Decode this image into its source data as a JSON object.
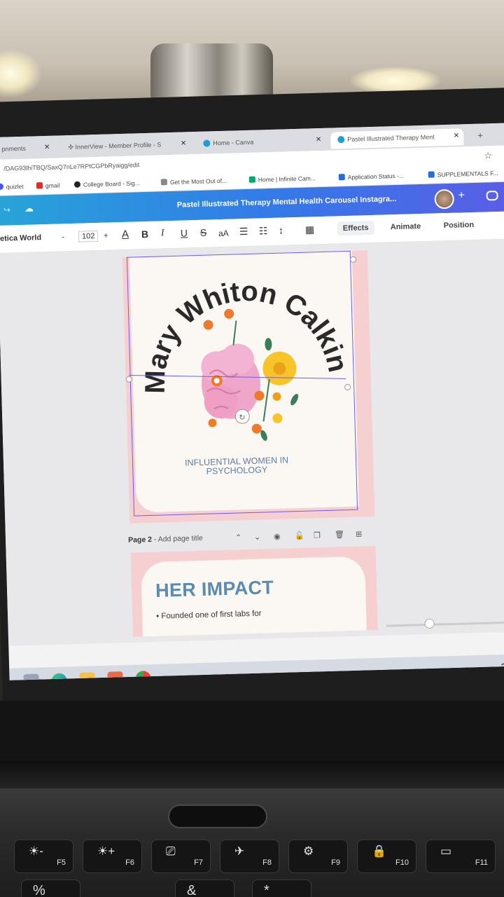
{
  "browser": {
    "tabs": [
      {
        "label": "pnments"
      },
      {
        "label": "InnerView - Member Profile - S"
      },
      {
        "label": "Home - Canva"
      },
      {
        "label": "Pastel Illustrated Therapy Ment"
      }
    ],
    "new_tab": "+",
    "url": "/DAG93lhiTBQ/SaxQ7nLe7RPtCGPbRyaigg/edit",
    "bookmarks": [
      {
        "label": "quizlet",
        "color": "#4255ff"
      },
      {
        "label": "gmail",
        "color": "#d93025"
      },
      {
        "label": "College Board - Sig...",
        "color": "#222222"
      },
      {
        "label": "Get the Most Out of...",
        "color": "#888888"
      },
      {
        "label": "Home | Infinite Cam...",
        "color": "#00a86b"
      },
      {
        "label": "Application Status -...",
        "color": "#2b6cd4"
      },
      {
        "label": "SUPPLEMENTALS F...",
        "color": "#2b6cd4"
      }
    ]
  },
  "canva": {
    "design_title": "Pastel Illustrated Therapy Mental Health Carousel Instagra...",
    "share_plus": "+",
    "toolbar": {
      "font": "etica World",
      "minus": "-",
      "font_size": "102",
      "plus": "+",
      "effects": "Effects",
      "animate": "Animate",
      "position": "Position"
    }
  },
  "page1": {
    "arc_title": "Mary Whiton Calkins",
    "subtitle_line1": "INFLUENTIAL WOMEN IN",
    "subtitle_line2": "PSYCHOLOGY"
  },
  "page2_bar": {
    "page_label": "Page 2",
    "title_placeholder": " - Add page title"
  },
  "page2": {
    "heading": "HER IMPACT",
    "bullet": "• Founded one of first labs for"
  },
  "keyboard": {
    "keys": [
      {
        "symbol": "☀-",
        "label": "F5"
      },
      {
        "symbol": "☀+",
        "label": "F6"
      },
      {
        "symbol": "⎚",
        "label": "F7"
      },
      {
        "symbol": "✈",
        "label": "F8"
      },
      {
        "symbol": "⚙",
        "label": "F9"
      },
      {
        "symbol": "🔒",
        "label": "F10"
      },
      {
        "symbol": "▭",
        "label": "F11"
      }
    ],
    "row2": [
      "%",
      "&",
      "*"
    ]
  }
}
